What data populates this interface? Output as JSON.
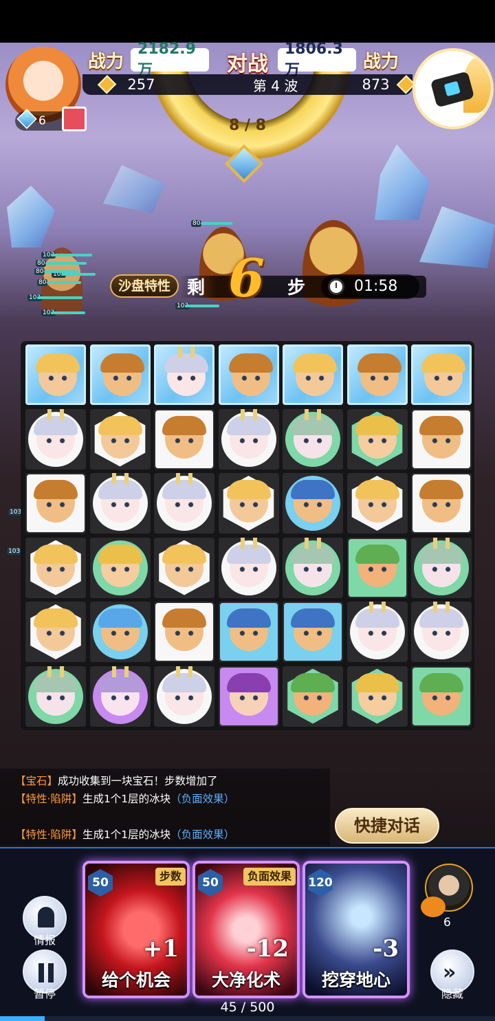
{
  "header": {
    "left_power_label": "战力",
    "left_power_value": "2182.9万",
    "vs_label": "对战",
    "right_power_value": "1806.3万",
    "right_power_label": "战力",
    "left_gems": "257",
    "wave_label": "第 4 波",
    "right_gems": "873",
    "wave_progress": "8 / 8"
  },
  "player": {
    "gem_count": "6"
  },
  "status": {
    "sandbox_button": "沙盘特性",
    "remaining_label": "剩",
    "steps_remaining": "6",
    "steps_label": "步",
    "timer": "01:58"
  },
  "scene_hp_labels": [
    "80",
    "80",
    "103",
    "103",
    "80",
    "103",
    "80",
    "103",
    "103",
    "103",
    "103"
  ],
  "board": {
    "columns": 7,
    "rows": 6,
    "tiles": [
      [
        "blonde",
        "monkey",
        "bunny",
        "monkey",
        "blonde",
        "monkey",
        "blonde"
      ],
      [
        "bunny",
        "blonde",
        "monkey",
        "bunny",
        "bunnygreen",
        "blondegreen",
        "monkey"
      ],
      [
        "monkey",
        "bunny",
        "bunny",
        "blonde",
        "blue",
        "blonde",
        "monkey"
      ],
      [
        "blonde",
        "blondegreen",
        "blonde",
        "bunny",
        "bunnygreen",
        "leaf",
        "bunnygreen"
      ],
      [
        "blonde",
        "crown",
        "monkey",
        "blue",
        "blue",
        "bunny",
        "bunny"
      ],
      [
        "bunnygreen",
        "violet",
        "bunny",
        "purple",
        "leaf",
        "blondegreen",
        "leaf"
      ]
    ],
    "backgrounds": [
      [
        "ice",
        "ice",
        "ice",
        "ice",
        "ice",
        "ice",
        "ice"
      ],
      [
        "circle",
        "hex",
        "square",
        "circle",
        "green",
        "greenhex",
        "square"
      ],
      [
        "square",
        "circle",
        "circle",
        "hex",
        "blue",
        "hex",
        "square"
      ],
      [
        "hex",
        "green",
        "hex",
        "circle",
        "green",
        "greensq",
        "green"
      ],
      [
        "hex",
        "blue",
        "square",
        "bluesq",
        "bluesq",
        "circle",
        "circle"
      ],
      [
        "green",
        "purplecirc",
        "circle",
        "purple",
        "greenhex",
        "greenhex",
        "greensq"
      ]
    ]
  },
  "log": [
    {
      "tag": "【宝石】",
      "text": "成功收集到一块宝石！步数增加了",
      "neg": ""
    },
    {
      "tag": "【特性·陷阱】",
      "text": "生成1个1层的冰块",
      "neg": "（负面效果）"
    },
    {
      "tag": "【特性·陷阱】",
      "text": "生成1个1层的冰块",
      "neg": "（负面效果）"
    }
  ],
  "quick_chat": "快捷对话",
  "controls": {
    "intel_label": "情报",
    "pause_label": "暂停",
    "hide_label": "隐藏"
  },
  "cards": [
    {
      "cost": "50",
      "tag": "步数",
      "bonus": "+1",
      "name": "给个机会",
      "color": "#c4161d"
    },
    {
      "cost": "50",
      "tag": "负面效果",
      "bonus": "-12",
      "name": "大净化术",
      "color": "#e2344a"
    },
    {
      "cost": "120",
      "tag": "",
      "bonus": "-3",
      "name": "挖穿地心",
      "color": "#3a4a8c"
    }
  ],
  "hero": {
    "count": "6"
  },
  "progress": {
    "text": "45 / 500",
    "fraction": 0.09
  },
  "colors": {
    "accent": "#3bb0ff",
    "card_glow": "#d693ff",
    "steps": "#ffbd2b",
    "log_tag": "#ff9a3b",
    "log_negative": "#5ab1ff"
  }
}
